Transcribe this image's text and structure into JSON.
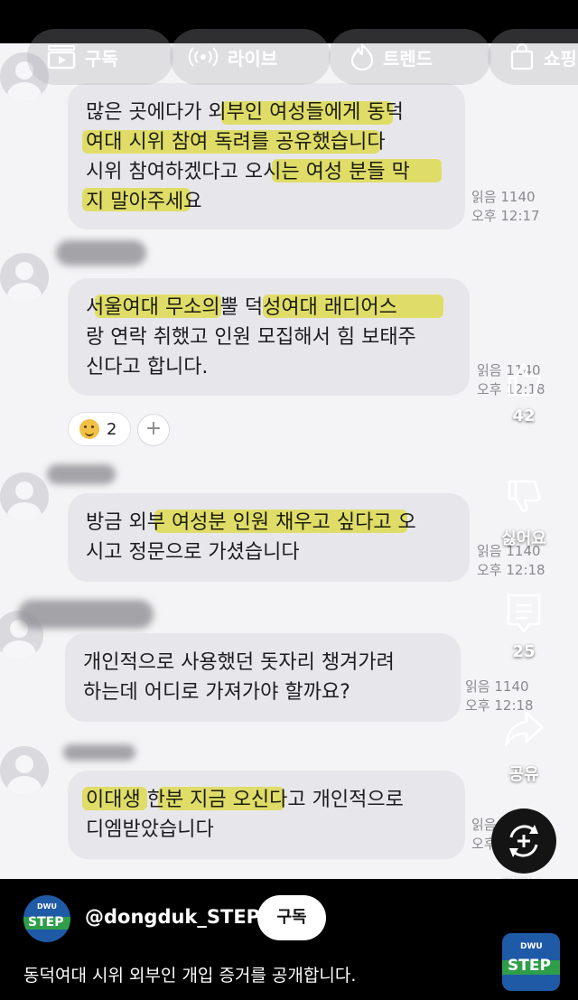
{
  "nav": {
    "tabs": [
      {
        "label": "구독",
        "icon": "subscriptions-icon"
      },
      {
        "label": "라이브",
        "icon": "live-icon"
      },
      {
        "label": "트렌드",
        "icon": "trending-icon"
      },
      {
        "label": "쇼핑",
        "icon": "shopping-bag-icon"
      }
    ]
  },
  "chat": {
    "messages": [
      {
        "lines": [
          "많은 곳에다가 외부인 여성들에게 동덕",
          "여대 시위 참여 독려를 공유했습니다",
          "시위 참여하겠다고 오시는 여성 분들 막",
          "지 말아주세요"
        ],
        "read": "읽음 1140",
        "time": "오후 12:17"
      },
      {
        "lines": [
          "서울여대 무소의뿔 덕성여대 래디어스",
          "랑 연락 취했고 인원 모집해서 힘 보태주",
          "신다고 합니다."
        ],
        "read": "읽음 1140",
        "time": "오후 12:18",
        "reaction_count": "2",
        "reaction_add": "+"
      },
      {
        "lines": [
          "방금 외부 여성분 인원 채우고 싶다고 오",
          "시고 정문으로 가셨습니다"
        ],
        "read": "읽음 1140",
        "time": "오후 12:18"
      },
      {
        "lines": [
          "개인적으로 사용했던 돗자리 챙겨가려",
          "하는데 어디로 가져가야 할까요?"
        ],
        "read": "읽음 1140",
        "time": "오후 12:18"
      },
      {
        "lines": [
          "이대생 한분 지금 오신다고 개인적으로",
          "디엠받았습니다"
        ],
        "read": "읽음 1140",
        "time": "오후 12:18"
      }
    ]
  },
  "actions": {
    "like_count": "42",
    "dislike_label": "싫어요",
    "comment_count": "25",
    "share_label": "공유",
    "remix_label": "리믹스"
  },
  "channel": {
    "handle": "@dongduk_STEP",
    "subscribe_label": "구독",
    "logo_small": "DWU",
    "logo_big": "STEP"
  },
  "video": {
    "title": "동덕여대 시위 외부인 개입 증거를 공개합니다."
  },
  "colors": {
    "highlight": "#f5f041",
    "bubble": "#e7e7eb",
    "logo_blue": "#1f5aa6",
    "logo_green": "#2e9e4a"
  }
}
